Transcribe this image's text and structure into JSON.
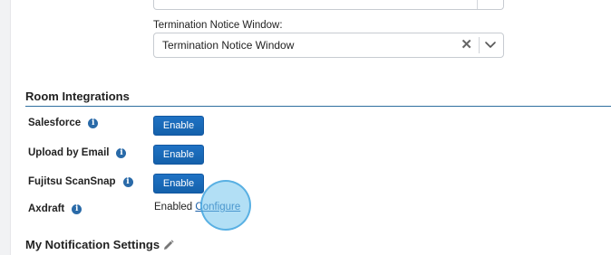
{
  "termination_field": {
    "label": "Termination Notice Window:",
    "value": "Termination Notice Window",
    "clear_glyph": "✕"
  },
  "room_integrations": {
    "title": "Room Integrations",
    "rows": [
      {
        "label": "Salesforce",
        "action_label": "Enable"
      },
      {
        "label": "Upload by Email",
        "action_label": "Enable"
      },
      {
        "label": "Fujitsu ScanSnap",
        "action_label": "Enable"
      },
      {
        "label": "Axdraft",
        "status": "Enabled",
        "link_label": "Configure"
      }
    ],
    "info_glyph": "i"
  },
  "notifications": {
    "title": "My Notification Settings"
  },
  "colors": {
    "accent": "#1f72c4",
    "section_rule": "#2f6f9f",
    "highlight": "#72c4ec"
  }
}
